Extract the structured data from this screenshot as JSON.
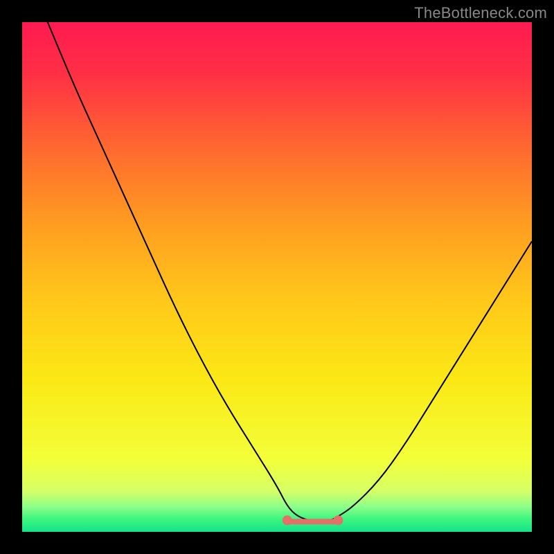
{
  "watermark": "TheBottleneck.com",
  "colors": {
    "frame": "#000000",
    "gradient_stops": [
      {
        "offset": 0.0,
        "color": "#ff1a52"
      },
      {
        "offset": 0.1,
        "color": "#ff2f45"
      },
      {
        "offset": 0.25,
        "color": "#ff6a2f"
      },
      {
        "offset": 0.4,
        "color": "#ff9e20"
      },
      {
        "offset": 0.55,
        "color": "#ffc91a"
      },
      {
        "offset": 0.7,
        "color": "#fbe815"
      },
      {
        "offset": 0.86,
        "color": "#f3ff3a"
      },
      {
        "offset": 0.92,
        "color": "#d6ff66"
      },
      {
        "offset": 0.95,
        "color": "#8fff8a"
      },
      {
        "offset": 0.975,
        "color": "#3cf57f"
      },
      {
        "offset": 1.0,
        "color": "#14e28a"
      }
    ],
    "curve": "#000000",
    "flat_segment": "#e37168"
  },
  "chart_data": {
    "type": "line",
    "title": "",
    "xlabel": "",
    "ylabel": "",
    "xlim": [
      0,
      100
    ],
    "ylim": [
      0,
      100
    ],
    "series": [
      {
        "name": "bottleneck-curve",
        "x": [
          5,
          10,
          15,
          20,
          25,
          30,
          35,
          40,
          45,
          50,
          52,
          54,
          57,
          60,
          62,
          65,
          70,
          75,
          80,
          85,
          90,
          95,
          100
        ],
        "y": [
          100,
          88,
          77,
          66,
          55,
          44,
          34,
          25,
          17,
          9,
          5,
          3,
          2,
          2,
          3,
          5,
          10,
          17,
          25,
          33,
          41,
          49,
          57
        ]
      },
      {
        "name": "optimal-flat",
        "x": [
          52,
          54,
          57,
          60,
          62
        ],
        "y": [
          3,
          2,
          2,
          2,
          3
        ]
      }
    ],
    "flat_region": {
      "x_start": 52,
      "x_end": 62,
      "y": 2
    }
  }
}
